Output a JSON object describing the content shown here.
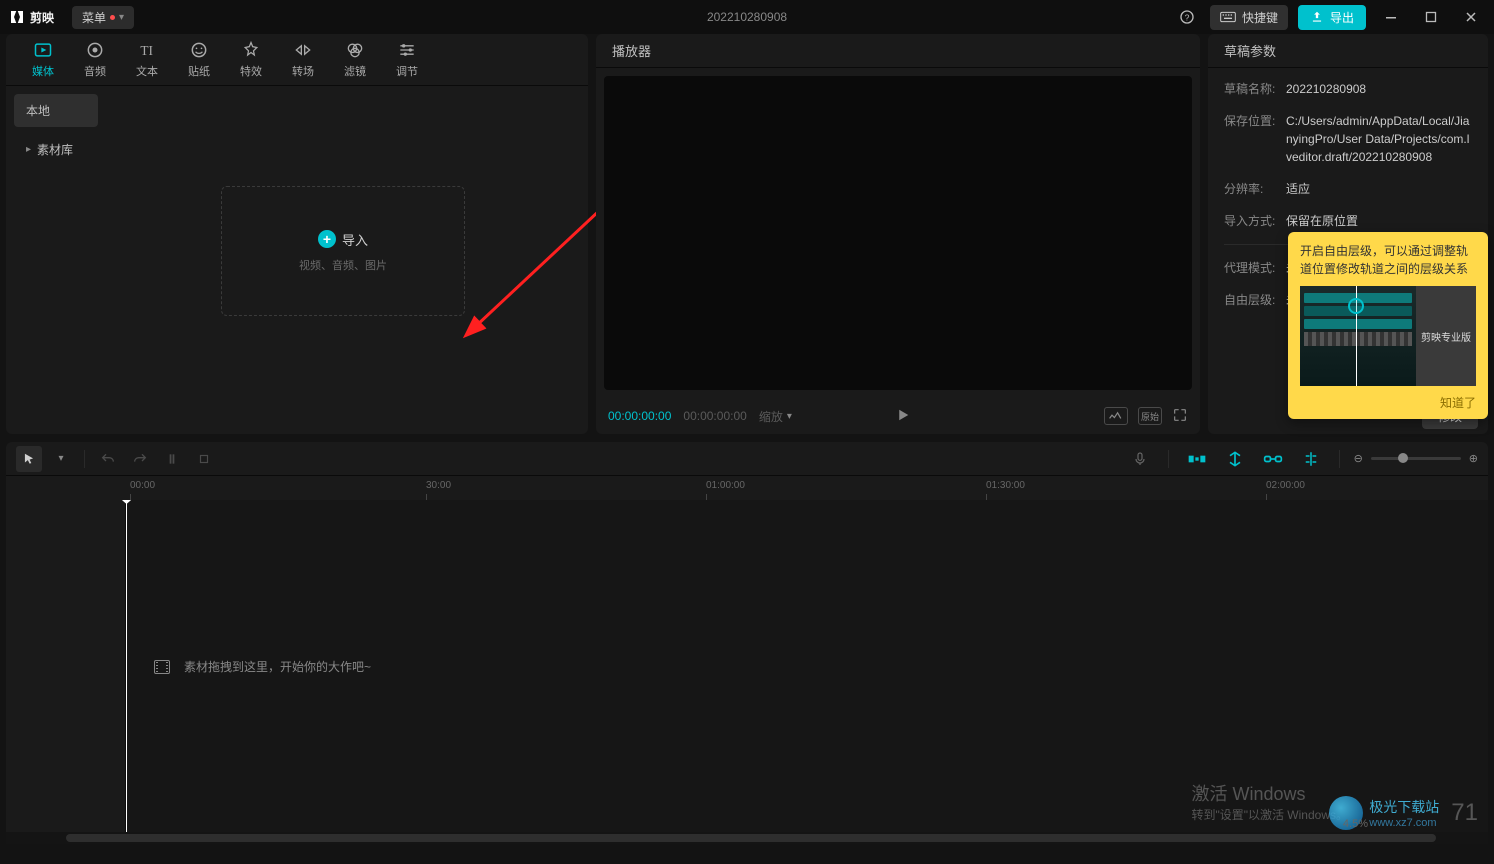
{
  "titlebar": {
    "app_name": "剪映",
    "menu_label": "菜单",
    "project_title": "202210280908",
    "shortcut_label": "快捷键",
    "export_label": "导出"
  },
  "media_tabs": [
    {
      "label": "媒体"
    },
    {
      "label": "音频"
    },
    {
      "label": "文本"
    },
    {
      "label": "贴纸"
    },
    {
      "label": "特效"
    },
    {
      "label": "转场"
    },
    {
      "label": "滤镜"
    },
    {
      "label": "调节"
    }
  ],
  "media_side": {
    "local": "本地",
    "library": "素材库"
  },
  "import": {
    "label": "导入",
    "hint": "视频、音频、图片"
  },
  "player": {
    "title": "播放器",
    "tc_current": "00:00:00:00",
    "tc_total": "00:00:00:00",
    "scale_label": "缩放"
  },
  "params": {
    "title": "草稿参数",
    "rows": {
      "name_label": "草稿名称:",
      "name_val": "202210280908",
      "path_label": "保存位置:",
      "path_val": "C:/Users/admin/AppData/Local/JianyingPro/User Data/Projects/com.lveditor.draft/202210280908",
      "res_label": "分辨率:",
      "res_val": "适应",
      "import_label": "导入方式:",
      "import_val": "保留在原位置",
      "proxy_label": "代理模式:",
      "proxy_val": "未开启",
      "free_label": "自由层级:",
      "free_val": "未开启"
    },
    "modify": "修改"
  },
  "tip": {
    "text": "开启自由层级，可以通过调整轨道位置修改轨道之间的层级关系",
    "thumb_label": "剪映专业版",
    "ok": "知道了"
  },
  "timeline": {
    "ticks": [
      "00:00",
      "30:00",
      "01:00:00",
      "01:30:00",
      "02:00:00"
    ],
    "drop_hint": "素材拖拽到这里，开始你的大作吧~",
    "zoom_label": "4.5%"
  },
  "watermark": {
    "activate": "激活 Windows",
    "goto": "转到\"设置\"以激活 Windows。",
    "site_name": "极光下载站",
    "site_url": "www.xz7.com",
    "num": "71"
  }
}
